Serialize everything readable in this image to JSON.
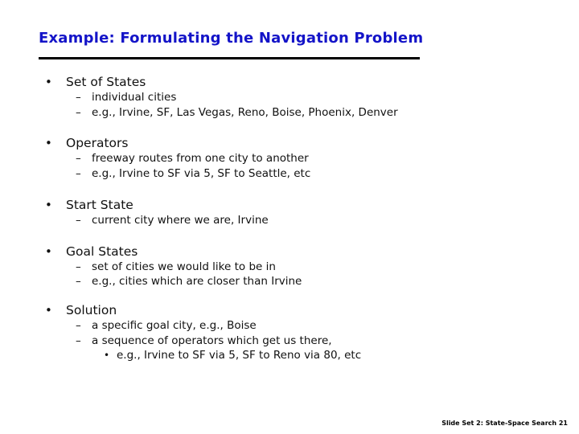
{
  "slide": {
    "title": "Example: Formulating the Navigation Problem",
    "footer": "Slide Set 2: State-Space Search 21",
    "bullet_glyph": "•",
    "dash_glyph": "–",
    "sections": [
      {
        "heading": "Set of States",
        "items": [
          {
            "text": "individual cities"
          },
          {
            "text": "e.g., Irvine, SF, Las Vegas, Reno, Boise, Phoenix, Denver"
          }
        ]
      },
      {
        "heading": "Operators",
        "items": [
          {
            "text": "freeway routes from one city to another"
          },
          {
            "text": "e.g., Irvine to SF via 5,  SF to Seattle, etc"
          }
        ]
      },
      {
        "heading": "Start State",
        "items": [
          {
            "text": "current city where we are, Irvine"
          }
        ]
      },
      {
        "heading": "Goal States",
        "items": [
          {
            "text": "set of cities we would like to be in"
          },
          {
            "text": "e.g., cities which are closer than Irvine"
          }
        ]
      },
      {
        "heading": "Solution",
        "items": [
          {
            "text": "a specific goal city, e.g., Boise"
          },
          {
            "text": "a sequence of operators which get us there,",
            "subitems": [
              {
                "text": "e.g.,  Irvine to SF via 5,  SF to Reno via 80, etc"
              }
            ]
          }
        ]
      }
    ]
  }
}
